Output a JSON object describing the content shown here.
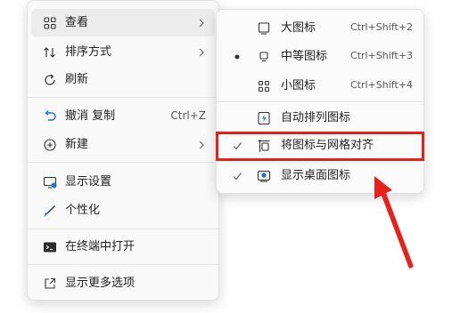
{
  "main_menu": {
    "items": [
      {
        "label": "查看",
        "icon": "grid-icon"
      },
      {
        "label": "排序方式",
        "icon": "sort-icon"
      },
      {
        "label": "刷新",
        "icon": "refresh-icon"
      },
      {
        "label": "撤消 复制",
        "icon": "undo-icon",
        "shortcut": "Ctrl+Z"
      },
      {
        "label": "新建",
        "icon": "new-icon"
      },
      {
        "label": "显示设置",
        "icon": "display-icon"
      },
      {
        "label": "个性化",
        "icon": "brush-icon"
      },
      {
        "label": "在终端中打开",
        "icon": "terminal-icon"
      },
      {
        "label": "显示更多选项",
        "icon": "share-icon"
      }
    ]
  },
  "view_submenu": {
    "items": [
      {
        "label": "大图标",
        "shortcut": "Ctrl+Shift+2"
      },
      {
        "label": "中等图标",
        "shortcut": "Ctrl+Shift+3",
        "selected": true
      },
      {
        "label": "小图标",
        "shortcut": "Ctrl+Shift+4"
      },
      {
        "label": "自动排列图标",
        "checked": false
      },
      {
        "label": "将图标与网格对齐",
        "checked": true
      },
      {
        "label": "显示桌面图标",
        "checked": true
      }
    ]
  },
  "annotation": {
    "color": "#e8201b"
  },
  "colors": {
    "menu_bg": "#f9f9f9",
    "hover_bg": "#ececec",
    "accent_blue": "#1a73c8"
  }
}
